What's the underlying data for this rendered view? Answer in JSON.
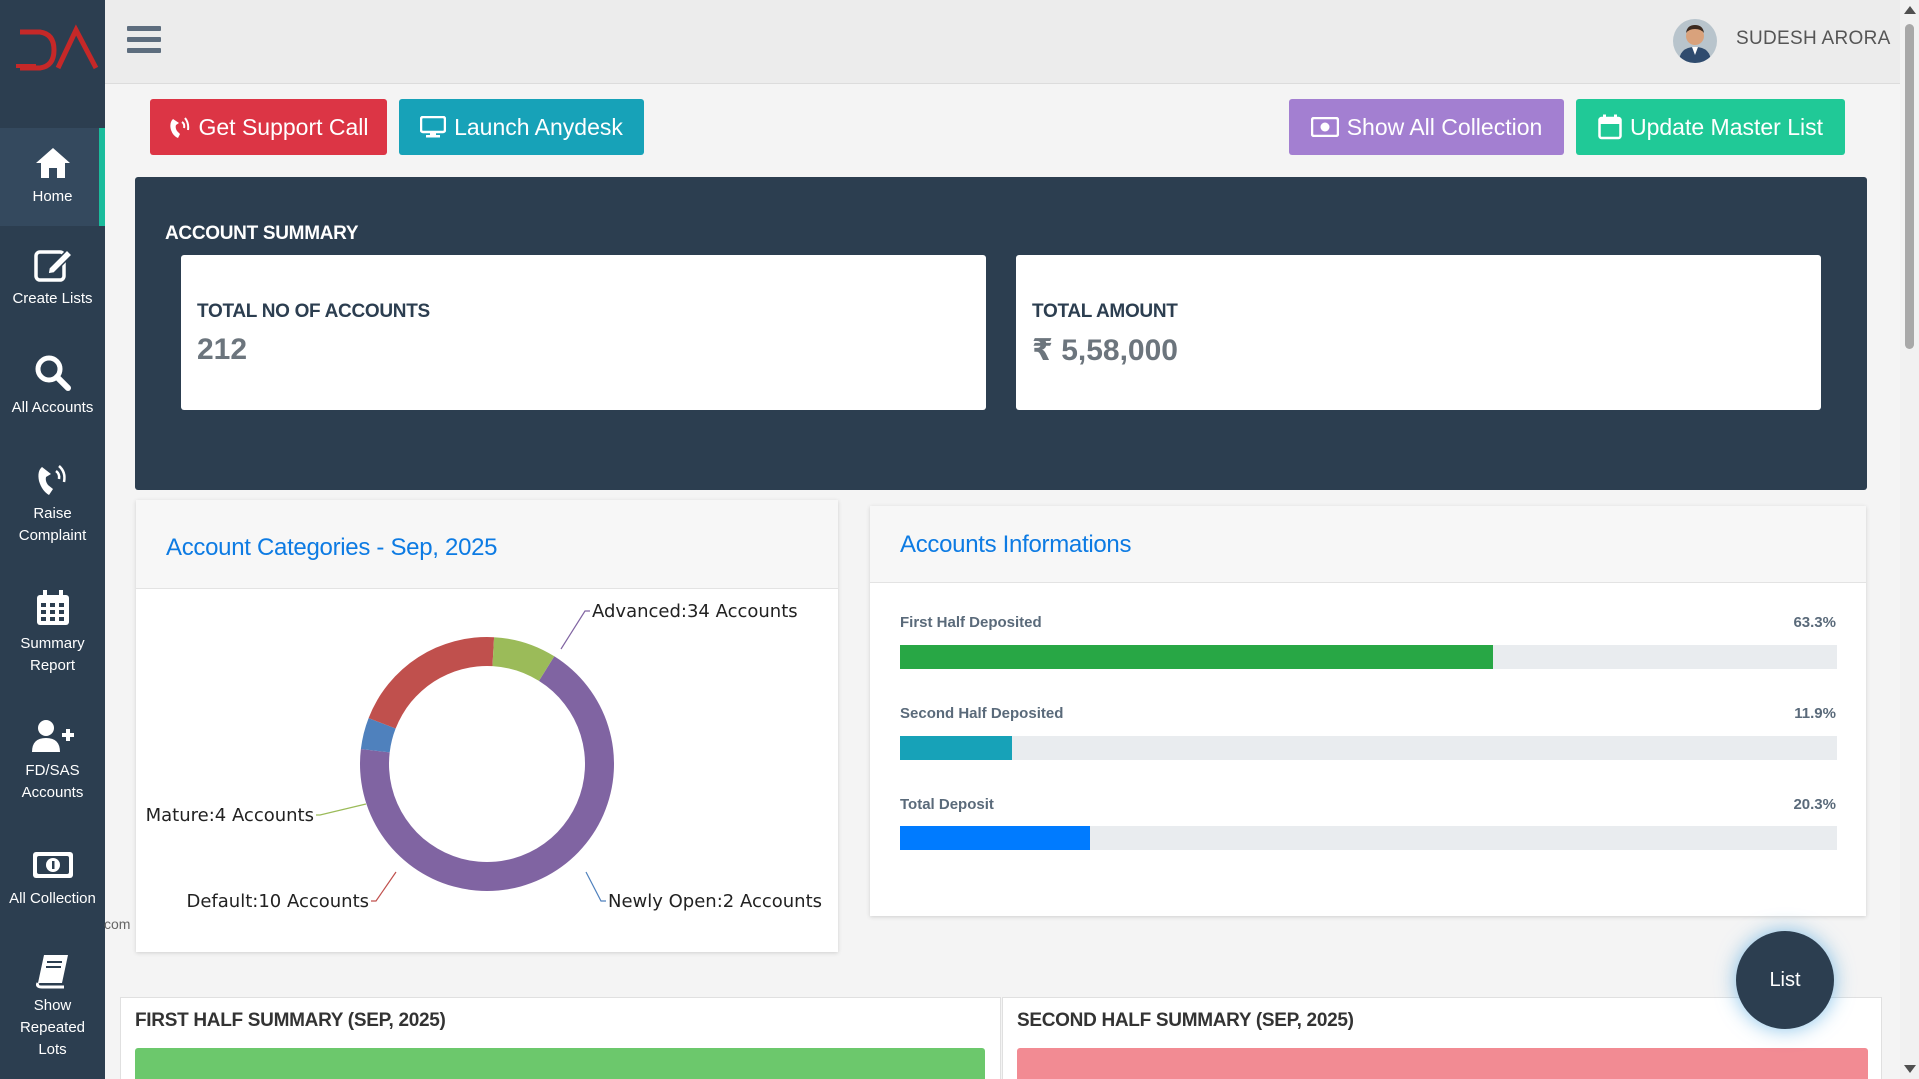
{
  "sidebar": {
    "logo_text": "DA",
    "items": [
      {
        "label": "Home",
        "icon": "home-icon"
      },
      {
        "label": "Create Lists",
        "icon": "edit-icon"
      },
      {
        "label": "All Accounts",
        "icon": "search-icon"
      },
      {
        "label": "Raise Complaint",
        "icon": "phone-volume-icon"
      },
      {
        "label": "Summary Report",
        "icon": "calendar-icon"
      },
      {
        "label": "FD/SAS Accounts",
        "icon": "user-plus-icon"
      },
      {
        "label": "All Collection",
        "icon": "money-bill-icon"
      },
      {
        "label": "Show Repeated Lots",
        "icon": "book-icon"
      }
    ]
  },
  "header": {
    "username": "SUDESH ARORA"
  },
  "actions": {
    "support": "Get Support Call",
    "anydesk": "Launch Anydesk",
    "show_collection": "Show All Collection",
    "update_master": "Update Master List"
  },
  "summary": {
    "title": "ACCOUNT SUMMARY",
    "accounts_label": "TOTAL NO OF ACCOUNTS",
    "accounts_value": "212",
    "amount_label": "TOTAL AMOUNT",
    "amount_value": "₹ 5,58,000"
  },
  "categories_panel": {
    "title": "Account Categories - Sep, 2025"
  },
  "chart_data": {
    "type": "pie",
    "title": "Account Categories - Sep, 2025",
    "slices": [
      {
        "name": "Advanced",
        "value": 34,
        "label": "Advanced:34 Accounts",
        "color": "#8064a2"
      },
      {
        "name": "Newly Open",
        "value": 2,
        "label": "Newly Open:2 Accounts",
        "color": "#4f81bd"
      },
      {
        "name": "Default",
        "value": 10,
        "label": "Default:10 Accounts",
        "color": "#c0504d"
      },
      {
        "name": "Mature",
        "value": 4,
        "label": "Mature:4 Accounts",
        "color": "#9bbb59"
      }
    ]
  },
  "info_panel": {
    "title": "Accounts Informations",
    "rows": [
      {
        "label": "First Half Deposited",
        "pct_text": "63.3%",
        "value": 0.633,
        "color": "#28a745"
      },
      {
        "label": "Second Half Deposited",
        "pct_text": "11.9%",
        "value": 0.119,
        "color": "#17a2b8"
      },
      {
        "label": "Total Deposit",
        "pct_text": "20.3%",
        "value": 0.203,
        "color": "#007bff"
      }
    ]
  },
  "bottom": {
    "first_title": "FIRST HALF SUMMARY (SEP, 2025)",
    "second_title": "SECOND HALF SUMMARY (SEP, 2025)"
  },
  "fab_label": "List",
  "footer_fragment": "com",
  "colors": {
    "sidebar": "#2c3e50",
    "support": "#dc3545",
    "anydesk": "#17a2b8",
    "collection": "#a37fd1",
    "master": "#20c997"
  }
}
